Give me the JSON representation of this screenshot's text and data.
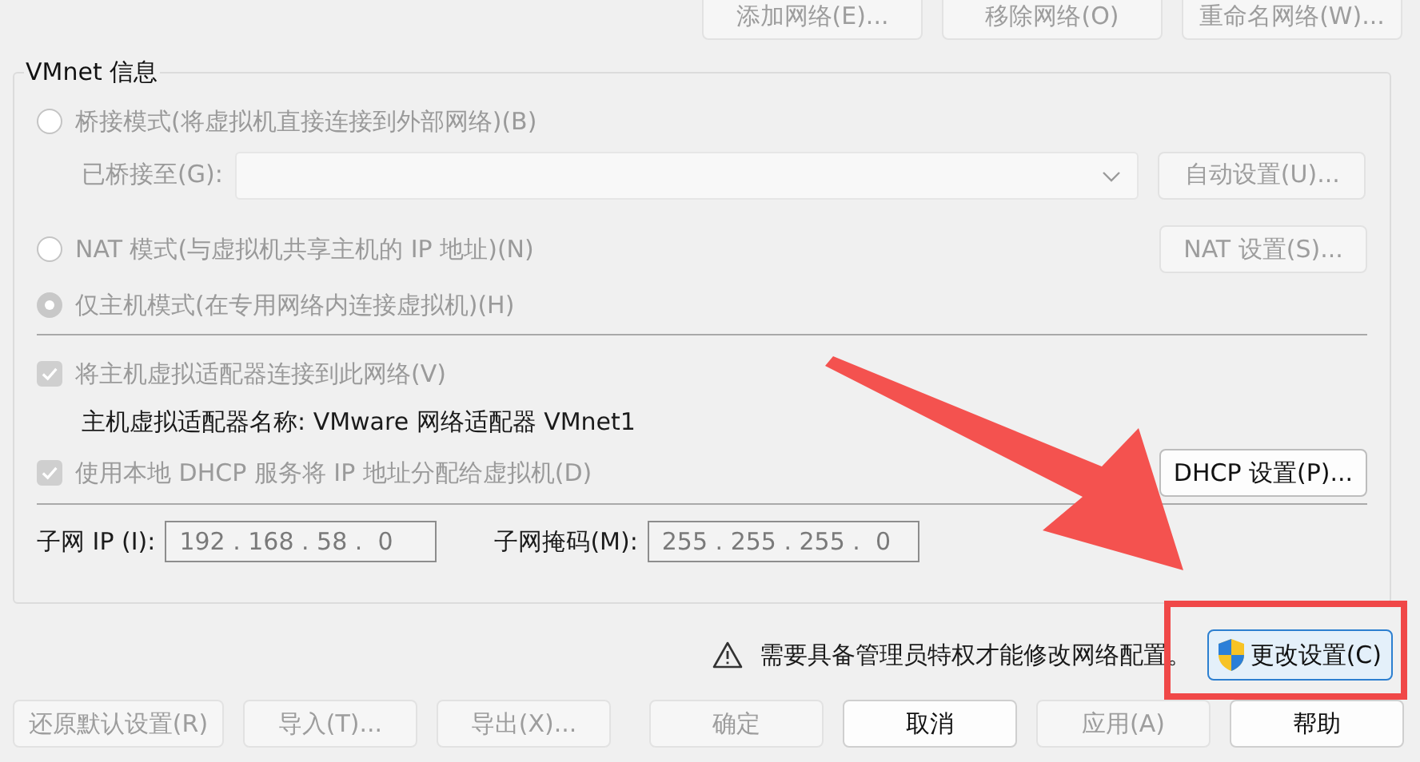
{
  "top_buttons": [
    {
      "label": "添加网络(E)...",
      "disabled": true
    },
    {
      "label": "移除网络(O)",
      "disabled": true
    },
    {
      "label": "重命名网络(W)...",
      "disabled": true
    }
  ],
  "vmnet_info": {
    "title": "VMnet 信息",
    "modes": [
      {
        "label": "桥接模式(将虚拟机直接连接到外部网络)(B)",
        "selected": false,
        "disabled": true
      },
      {
        "label": "NAT 模式(与虚拟机共享主机的 IP 地址)(N)",
        "selected": false,
        "disabled": true
      },
      {
        "label": "仅主机模式(在专用网络内连接虚拟机)(H)",
        "selected": true,
        "disabled": true
      }
    ],
    "bridged_to": {
      "label": "已桥接至(G):",
      "disabled": true
    },
    "auto_button": {
      "label": "自动设置(U)...",
      "disabled": true
    },
    "nat_button": {
      "label": "NAT 设置(S)...",
      "disabled": true
    },
    "options": [
      {
        "label": "将主机虚拟适配器连接到此网络(V)",
        "checked": true,
        "disabled": true
      },
      {
        "label": "使用本地 DHCP 服务将 IP 地址分配给虚拟机(D)",
        "checked": true,
        "disabled": true
      }
    ],
    "adapter_name": "主机虚拟适配器名称: VMware 网络适配器 VMnet1",
    "dhcp_button": {
      "label": "DHCP 设置(P)...",
      "disabled": false
    },
    "subnet_ip": {
      "label": "子网 IP (I):",
      "value": "192 . 168 . 58 .  0"
    },
    "subnet_mask": {
      "label": "子网掩码(M):",
      "value": "255 . 255 . 255 .  0"
    }
  },
  "warning": {
    "text": "需要具备管理员特权才能修改网络配置。",
    "button": {
      "label": "更改设置(C)",
      "disabled": false
    }
  },
  "bottom_buttons": [
    {
      "label": "还原默认设置(R)",
      "disabled": true
    },
    {
      "label": "导入(T)...",
      "disabled": true
    },
    {
      "label": "导出(X)...",
      "disabled": true
    },
    {
      "label": "确定",
      "disabled": true
    },
    {
      "label": "取消",
      "disabled": false
    },
    {
      "label": "应用(A)",
      "disabled": true
    },
    {
      "label": "帮助",
      "disabled": false
    }
  ]
}
